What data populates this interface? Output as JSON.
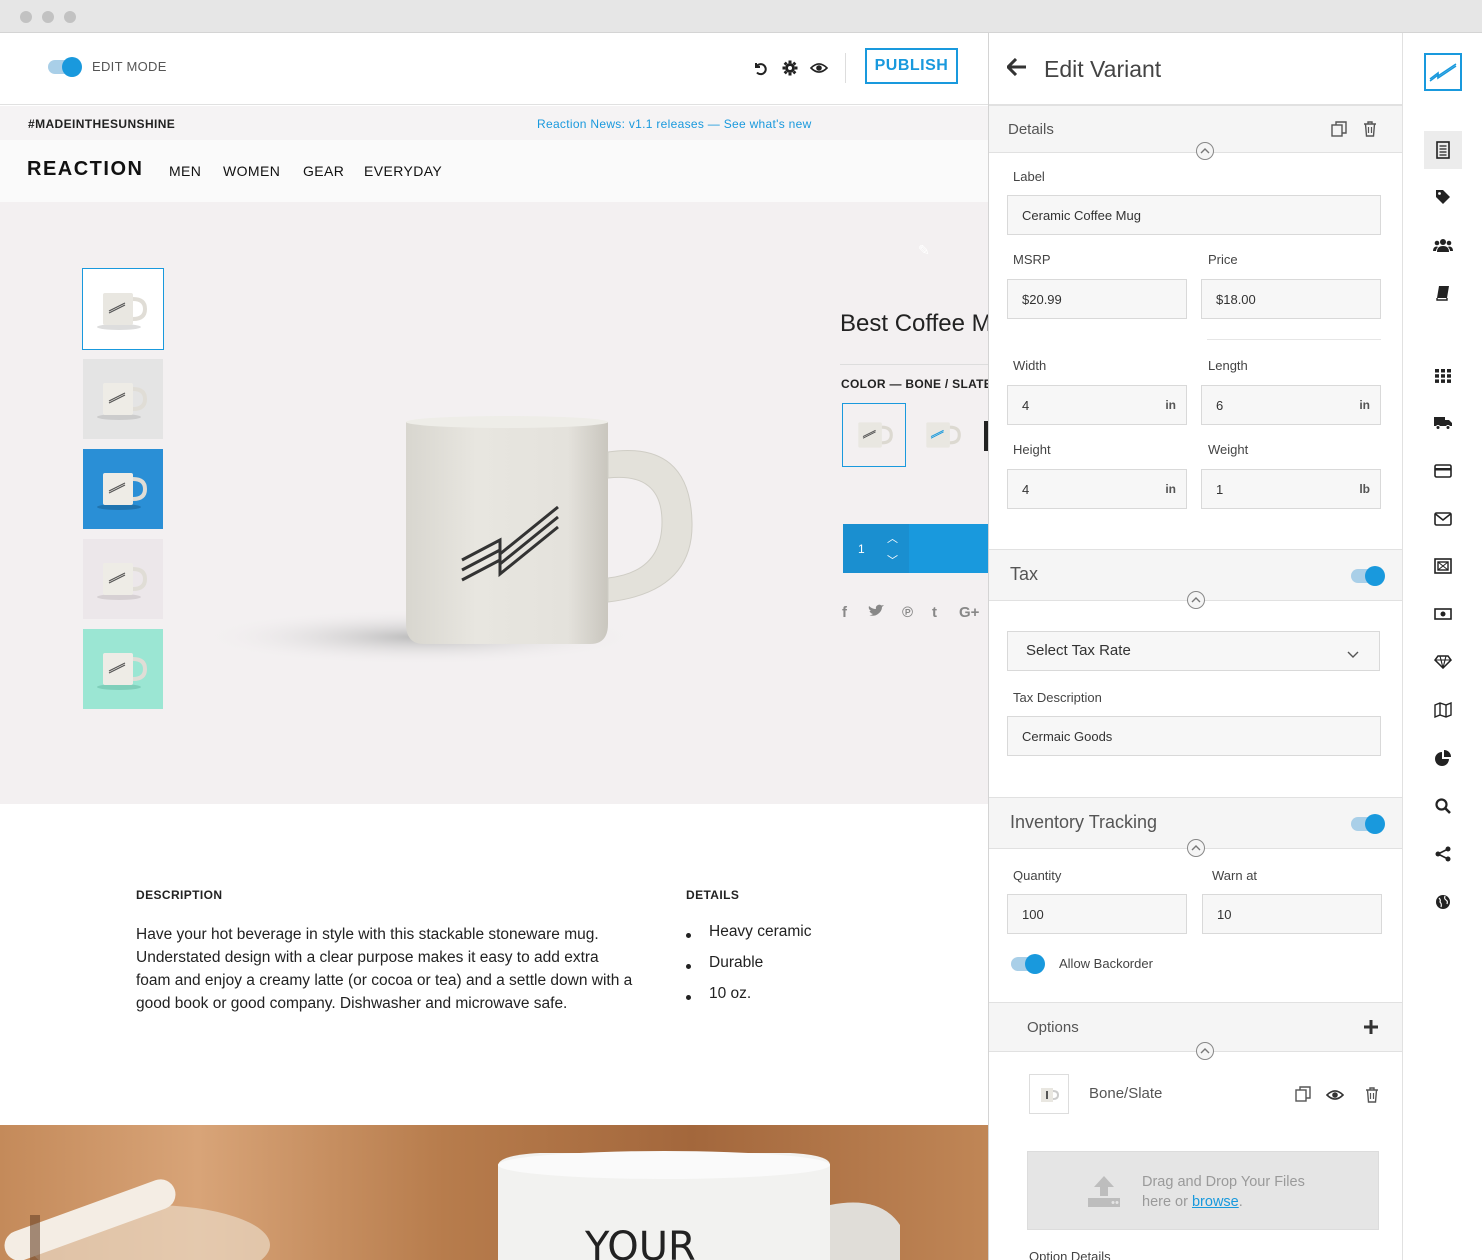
{
  "edit_bar": {
    "edit_mode_label": "EDIT MODE",
    "publish_label": "PUBLISH",
    "icons": [
      "undo-icon",
      "gear-icon",
      "eye-icon"
    ]
  },
  "news_bar": {
    "hashtag": "#MADEINTHESUNSHINE",
    "news": "Reaction News: v1.1 releases — See what's new"
  },
  "nav": {
    "brand": "REACTION",
    "items": [
      "MEN",
      "WOMEN",
      "GEAR",
      "EVERYDAY"
    ]
  },
  "product": {
    "title": "Best Coffee M",
    "color_label": "COLOR — BONE / SLATE",
    "quantity": "1",
    "share_icons": [
      "facebook-icon",
      "twitter-icon",
      "pinterest-icon",
      "tumblr-icon",
      "googleplus-icon"
    ],
    "thumbnail_backgrounds": [
      "#ffffff",
      "#e4e4e4",
      "#2a8fd6",
      "#ece7ea",
      "#9be6d3"
    ]
  },
  "description": {
    "heading": "DESCRIPTION",
    "text": "Have your hot beverage in style with this stackable stoneware mug. Understated design with a clear purpose makes it easy to add extra foam and enjoy a creamy latte (or cocoa or tea) and a settle down with a good book or good company. Dishwasher and microwave safe."
  },
  "details": {
    "heading": "DETAILS",
    "items": [
      "Heavy ceramic",
      "Durable",
      "10 oz."
    ]
  },
  "panel": {
    "title": "Edit Variant",
    "details": {
      "title": "Details",
      "label_label": "Label",
      "label_value": "Ceramic Coffee Mug",
      "msrp_label": "MSRP",
      "msrp_value": "$20.99",
      "price_label": "Price",
      "price_value": "$18.00",
      "width_label": "Width",
      "width_value": "4",
      "width_unit": "in",
      "length_label": "Length",
      "length_value": "6",
      "length_unit": "in",
      "height_label": "Height",
      "height_value": "4",
      "height_unit": "in",
      "weight_label": "Weight",
      "weight_value": "1",
      "weight_unit": "lb"
    },
    "tax": {
      "title": "Tax",
      "enabled": true,
      "select_value": "Select Tax Rate",
      "desc_label": "Tax Description",
      "desc_value": "Cermaic Goods"
    },
    "inventory": {
      "title": "Inventory Tracking",
      "enabled": true,
      "quantity_label": "Quantity",
      "quantity_value": "100",
      "warn_label": "Warn at",
      "warn_value": "10",
      "backorder_label": "Allow Backorder",
      "backorder_enabled": true
    },
    "options": {
      "title": "Options",
      "item_label": "Bone/Slate",
      "dropzone_line1": "Drag and Drop Your Files",
      "dropzone_line2": "here or",
      "dropzone_link": "browse",
      "dropzone_end": ".",
      "next_label": "Option Details"
    }
  },
  "rail": {
    "icons": [
      "logo-icon",
      "document-icon",
      "tag-icon",
      "users-icon",
      "book-icon",
      "grid-icon",
      "truck-icon",
      "credit-card-icon",
      "mail-icon",
      "layout-icon",
      "money-icon",
      "diamond-icon",
      "map-icon",
      "pie-chart-icon",
      "search-icon",
      "share-icon",
      "globe-icon"
    ]
  },
  "colors": {
    "accent": "#1999dd",
    "hero_bg": "#f3f0f1"
  }
}
